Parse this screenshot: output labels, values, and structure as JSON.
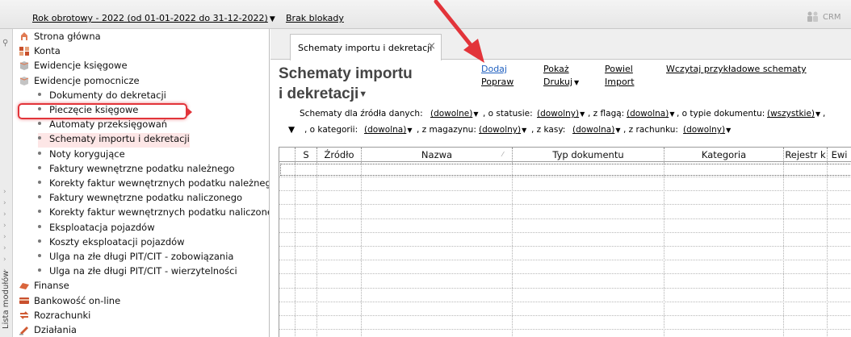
{
  "topbar": {
    "fiscal_year": "Rok obrotowy - 2022  (od 01-01-2022 do 31-12-2022)",
    "lock_status": "Brak blokady",
    "crm_label": "CRM"
  },
  "strip": {
    "label": "Lista modułów"
  },
  "sidebar": {
    "top_items": [
      {
        "label": "Strona główna",
        "icon": "home-icon"
      },
      {
        "label": "Konta",
        "icon": "accounts-icon"
      },
      {
        "label": "Ewidencje księgowe",
        "icon": "ledger-icon"
      },
      {
        "label": "Ewidencje pomocnicze",
        "icon": "auxiliary-ledger-icon"
      }
    ],
    "sub_items": [
      "Dokumenty do dekretacji",
      "Pieczęcie księgowe",
      "Automaty przeksięgowań",
      "Schematy importu i dekretacji",
      "Noty korygujące",
      "Faktury wewnętrzne podatku należnego",
      "Korekty faktur wewnętrznych podatku należnego",
      "Faktury wewnętrzne podatku naliczonego",
      "Korekty faktur wewnętrznych podatku naliczonego",
      "Eksploatacja pojazdów",
      "Koszty eksploatacji pojazdów",
      "Ulga na złe długi PIT/CIT - zobowiązania",
      "Ulga na złe długi PIT/CIT - wierzytelności"
    ],
    "bottom_items": [
      {
        "label": "Finanse",
        "icon": "finance-icon"
      },
      {
        "label": "Bankowość on-line",
        "icon": "online-banking-icon"
      },
      {
        "label": "Rozrachunki",
        "icon": "settlements-icon"
      },
      {
        "label": "Działania",
        "icon": "actions-icon"
      }
    ],
    "selected_index": 3
  },
  "tab": {
    "label": "Schematy importu i dekretacji",
    "close": "×"
  },
  "page": {
    "title_line1": "Schematy importu",
    "title_line2": "i dekretacji"
  },
  "actions": {
    "add": "Dodaj",
    "edit": "Popraw",
    "show": "Pokaż",
    "print": "Drukuj",
    "duplicate": "Powiel",
    "import": "Import",
    "load_samples": "Wczytaj przykładowe schematy"
  },
  "filters": {
    "source_label": "Schematy dla źródła danych:",
    "source_value": "(dowolne)",
    "status_label": ", o statusie:",
    "status_value": "(dowolny)",
    "flag_label": ", z flagą:",
    "flag_value": "(dowolna)",
    "doctype_label": ", o typie dokumentu:",
    "doctype_value": "(wszystkie)",
    "trail_comma": ",",
    "category_label": ", o kategorii:",
    "category_value": "(dowolna)",
    "warehouse_label": ", z magazynu:",
    "warehouse_value": "(dowolny)",
    "cashbox_label": ", z kasy:",
    "cashbox_value": "(dowolna)",
    "account_label": ", z rachunku:",
    "account_value": "(dowolny)"
  },
  "grid": {
    "columns": [
      "S",
      "Źródło",
      "Nazwa",
      "Typ dokumentu",
      "Kategoria",
      "Rejestr k",
      "Ewi"
    ]
  },
  "colors": {
    "annotation_red": "#e2343a",
    "link_blue": "#1e5fbf",
    "title_gray": "#444444"
  }
}
